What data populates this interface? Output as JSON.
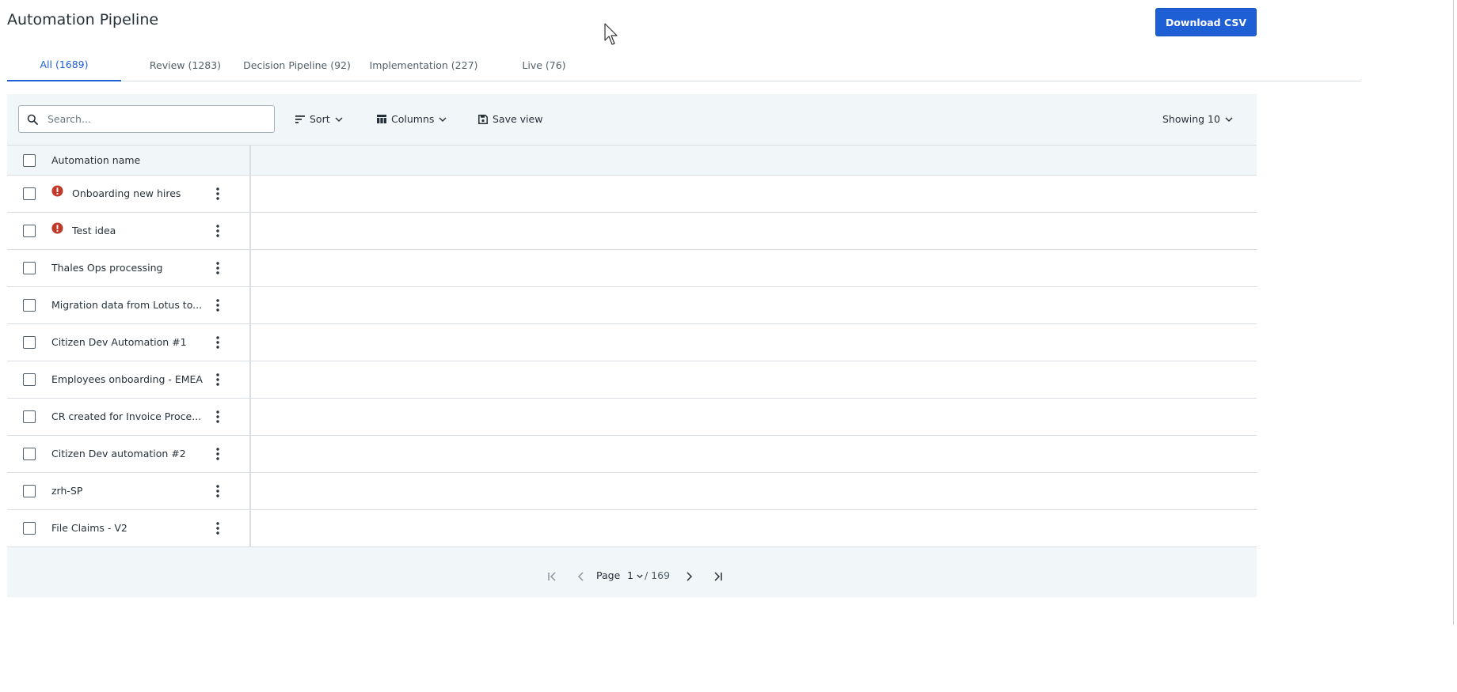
{
  "header": {
    "title": "Automation Pipeline",
    "download_label": "Download CSV"
  },
  "tabs": [
    {
      "label": "All (1689)",
      "active": true
    },
    {
      "label": "Review (1283)",
      "active": false
    },
    {
      "label": "Decision Pipeline (92)",
      "active": false
    },
    {
      "label": "Implementation (227)",
      "active": false
    },
    {
      "label": "Live (76)",
      "active": false
    }
  ],
  "toolbar": {
    "search_placeholder": "Search...",
    "sort_label": "Sort",
    "columns_label": "Columns",
    "save_view_label": "Save view",
    "showing_label": "Showing 10"
  },
  "table": {
    "header": "Automation name",
    "rows": [
      {
        "name": "Onboarding new hires",
        "error": true
      },
      {
        "name": "Test idea",
        "error": true
      },
      {
        "name": "Thales Ops processing",
        "error": false
      },
      {
        "name": "Migration data from Lotus to...",
        "error": false
      },
      {
        "name": "Citizen Dev Automation #1",
        "error": false
      },
      {
        "name": "Employees onboarding - EMEA",
        "error": false
      },
      {
        "name": "CR created for Invoice Proce...",
        "error": false
      },
      {
        "name": "Citizen Dev automation #2",
        "error": false
      },
      {
        "name": "zrh-SP",
        "error": false
      },
      {
        "name": "File Claims - V2",
        "error": false
      }
    ]
  },
  "pager": {
    "page_label": "Page",
    "current_page": "1",
    "total_pages": "/ 169"
  },
  "colors": {
    "accent": "#1f5fd6",
    "error": "#c0392b",
    "panel": "#f1f6f8"
  }
}
